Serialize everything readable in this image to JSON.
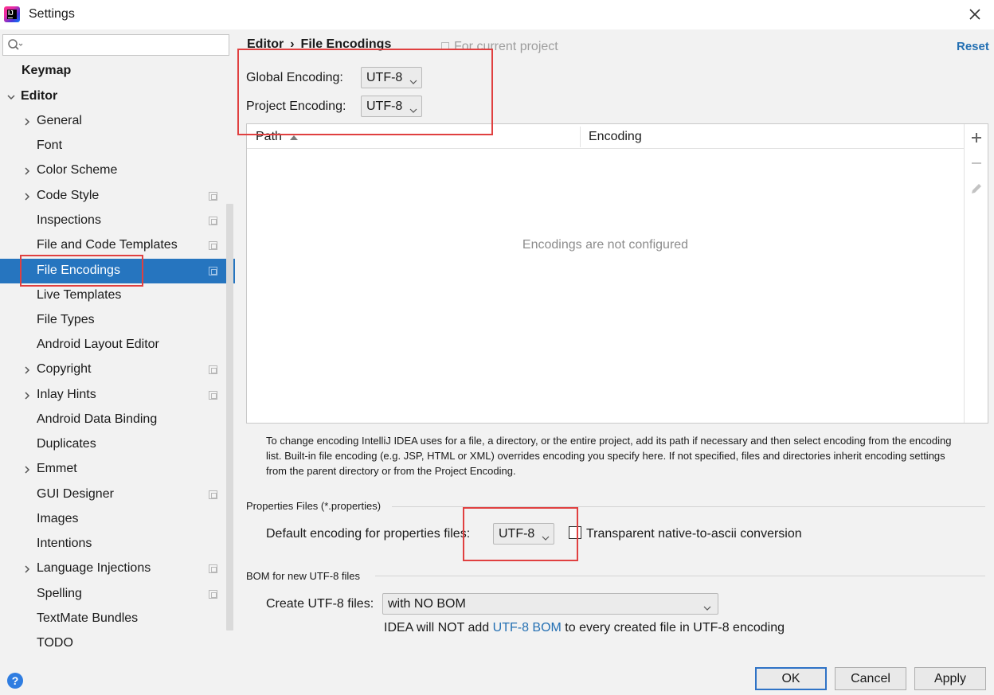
{
  "window": {
    "title": "Settings"
  },
  "search": {
    "placeholder": "",
    "value": ""
  },
  "sidebar": {
    "items": [
      {
        "label": "Keymap"
      },
      {
        "label": "Editor"
      },
      {
        "label": "General"
      },
      {
        "label": "Font"
      },
      {
        "label": "Color Scheme"
      },
      {
        "label": "Code Style"
      },
      {
        "label": "Inspections"
      },
      {
        "label": "File and Code Templates"
      },
      {
        "label": "File Encodings"
      },
      {
        "label": "Live Templates"
      },
      {
        "label": "File Types"
      },
      {
        "label": "Android Layout Editor"
      },
      {
        "label": "Copyright"
      },
      {
        "label": "Inlay Hints"
      },
      {
        "label": "Android Data Binding"
      },
      {
        "label": "Duplicates"
      },
      {
        "label": "Emmet"
      },
      {
        "label": "GUI Designer"
      },
      {
        "label": "Images"
      },
      {
        "label": "Intentions"
      },
      {
        "label": "Language Injections"
      },
      {
        "label": "Spelling"
      },
      {
        "label": "TextMate Bundles"
      },
      {
        "label": "TODO"
      }
    ],
    "selected": "File Encodings",
    "selection_color": "#2675bf"
  },
  "header": {
    "breadcrumb_parent": "Editor",
    "breadcrumb_separator": "›",
    "breadcrumb_current": "File Encodings",
    "for_current_project": "For current project",
    "reset_label": "Reset"
  },
  "encodings": {
    "global_label": "Global Encoding:",
    "global_value": "UTF-8",
    "project_label": "Project Encoding:",
    "project_value": "UTF-8"
  },
  "table": {
    "columns": [
      "Path",
      "Encoding"
    ],
    "empty_message": "Encodings are not configured",
    "toolbar": [
      "add-icon",
      "remove-icon",
      "edit-icon"
    ]
  },
  "help_text": "To change encoding IntelliJ IDEA uses for a file, a directory, or the entire project, add its path if necessary and then select encoding from the encoding list. Built-in file encoding (e.g. JSP, HTML or XML) overrides encoding you specify here. If not specified, files and directories inherit encoding settings from the parent directory or from the Project Encoding.",
  "properties": {
    "section_title": "Properties Files (*.properties)",
    "default_label": "Default encoding for properties files:",
    "default_value": "UTF-8",
    "native_to_ascii_label": "Transparent native-to-ascii conversion",
    "native_to_ascii_checked": false
  },
  "bom": {
    "section_title": "BOM for new UTF-8 files",
    "create_label": "Create UTF-8 files:",
    "create_value": "with NO BOM",
    "note_prefix": "IDEA will NOT add ",
    "note_link": "UTF-8 BOM",
    "note_suffix": " to every created file in UTF-8 encoding"
  },
  "buttons": {
    "ok": "OK",
    "cancel": "Cancel",
    "apply": "Apply",
    "help": "?"
  },
  "colors": {
    "accent": "#2675bf",
    "link": "#2470b3",
    "highlight": "#e04040"
  }
}
